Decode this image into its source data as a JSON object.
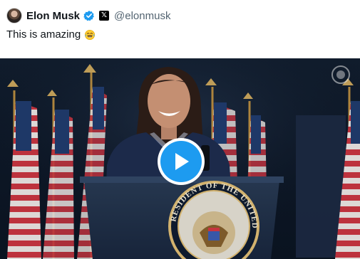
{
  "post": {
    "author": {
      "display_name": "Elon Musk",
      "handle": "@elonmusk",
      "verified_icon": "verified-badge-icon",
      "affiliation_icon": "x-logo-icon",
      "affiliation_glyph": "𝕏"
    },
    "text": "This is amazing",
    "emoji": "face-with-tears-of-joy"
  },
  "media": {
    "type": "video",
    "play_icon": "play-icon",
    "watermark_icon": "seal-watermark-icon",
    "seal_text": "RESIDENT OF THE UNITED"
  },
  "colors": {
    "accent": "#1d9bf0",
    "text_primary": "#0f1419",
    "text_secondary": "#536471",
    "verified": "#1d9bf0"
  }
}
